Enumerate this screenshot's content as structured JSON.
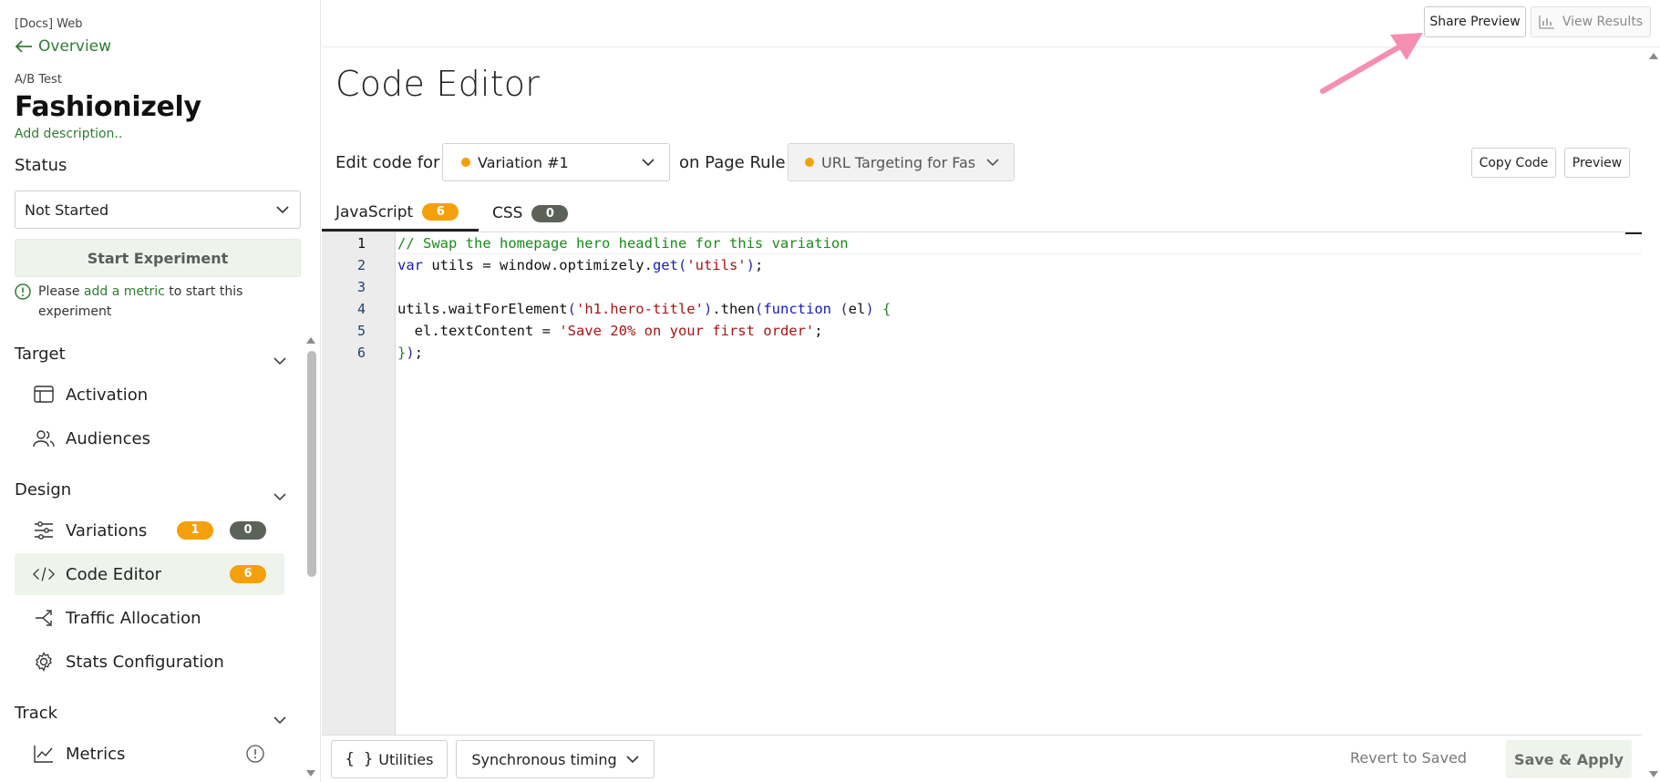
{
  "sidebar": {
    "project": "[Docs] Web",
    "back_label": "Overview",
    "experiment_type": "A/B Test",
    "experiment_name": "Fashionizely",
    "add_description": "Add description..",
    "status_label": "Status",
    "status_value": "Not Started",
    "start_button": "Start Experiment",
    "hint": {
      "before": "Please ",
      "link": "add a metric",
      "after": " to start this experiment"
    },
    "sections": {
      "target": {
        "title": "Target",
        "items": [
          {
            "label": "Activation",
            "icon": "layout-icon"
          },
          {
            "label": "Audiences",
            "icon": "users-icon"
          }
        ]
      },
      "design": {
        "title": "Design",
        "items": [
          {
            "label": "Variations",
            "icon": "sliders-icon",
            "badge_orange": "1",
            "badge_dark": "0"
          },
          {
            "label": "Code Editor",
            "icon": "code-icon",
            "badge_orange": "6",
            "active": true
          },
          {
            "label": "Traffic Allocation",
            "icon": "share-icon"
          },
          {
            "label": "Stats Configuration",
            "icon": "gear-icon"
          }
        ]
      },
      "track": {
        "title": "Track",
        "items": [
          {
            "label": "Metrics",
            "icon": "chart-line-icon"
          }
        ]
      }
    }
  },
  "topbar": {
    "share_preview": "Share Preview",
    "view_results": "View Results"
  },
  "page": {
    "title": "Code Editor",
    "edit_code_for": "Edit code for",
    "variation": "Variation #1",
    "on_page_rule": "on Page Rule",
    "page_rule": "URL Targeting for Fas",
    "copy_code": "Copy Code",
    "preview": "Preview"
  },
  "tabs": [
    {
      "label": "JavaScript",
      "count": "6",
      "active": true
    },
    {
      "label": "CSS",
      "count": "0"
    }
  ],
  "editor": {
    "line_numbers": [
      "1",
      "2",
      "3",
      "4",
      "5",
      "6"
    ],
    "lines": [
      "// Swap the homepage hero headline for this variation",
      "var utils = window.optimizely.get('utils');",
      "",
      "utils.waitForElement('h1.hero-title').then(function (el) {",
      "  el.textContent = 'Save 20% on your first order';",
      "});"
    ]
  },
  "bottombar": {
    "utilities": "Utilities",
    "timing": "Synchronous timing",
    "revert": "Revert to Saved",
    "save": "Save & Apply"
  },
  "colors": {
    "accent_green": "#2e7d32",
    "badge_orange": "#f5a00a",
    "badge_dark": "#5c6258",
    "active_bg": "#eef4ec",
    "arrow_pink": "#f48fb1"
  }
}
